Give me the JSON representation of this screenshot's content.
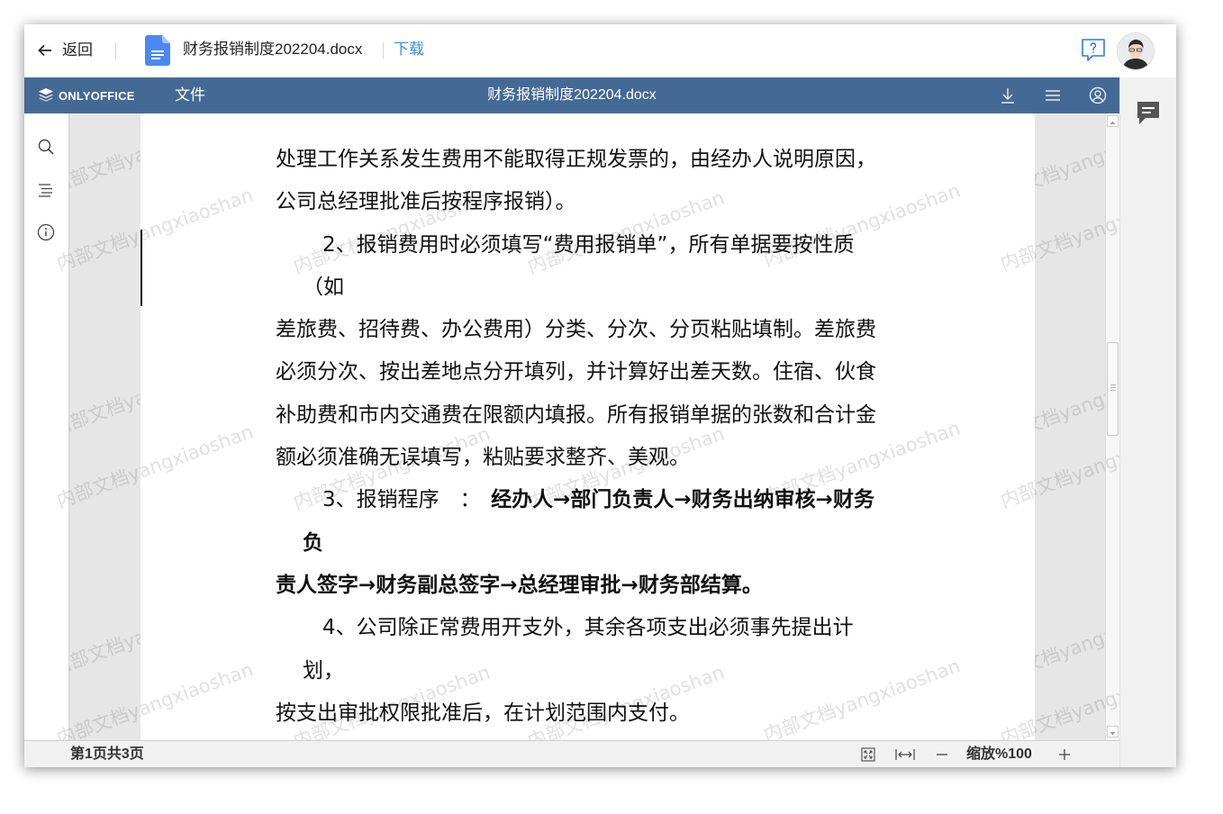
{
  "topbar": {
    "back_label": "返回",
    "filename": "财务报销制度202204.docx",
    "download_label": "下载",
    "icons": {
      "back": "arrow-left-icon",
      "file": "docx-file-icon",
      "help": "help-chat-icon",
      "avatar": "user-avatar"
    }
  },
  "editor_header": {
    "logo_text": "ONLYOFFICE",
    "file_menu_label": "文件",
    "title": "财务报销制度202204.docx",
    "icons": [
      "download-icon",
      "menu-icon",
      "account-icon"
    ]
  },
  "left_sidebar": {
    "icons": [
      "search-icon",
      "navigation-icon",
      "info-icon"
    ]
  },
  "right_sidebar": {
    "icons": [
      "comments-icon"
    ]
  },
  "document": {
    "lines": [
      "处理工作关系发生费用不能取得正规发票的，由经办人说明原因，",
      "公司总经理批准后按程序报销）。",
      "2、报销费用时必须填写“费用报销单”，所有单据要按性质",
      "（如",
      "差旅费、招待费、办公费用）分类、分次、分页粘贴填制。差旅费",
      "必须分次、按出差地点分开填列，并计算好出差天数。住宿、伙食",
      "补助费和市内交通费在限额内填报。所有报销单据的张数和合计金",
      "额必须准确无误填写，粘贴要求整齐、美观。",
      {
        "normal": "3、报销程序　：　",
        "bold": "经办人→部门负责人→财务出纳审核→财务"
      },
      "负",
      "责人签字→财务副总签字→总经理审批→财务部结算。",
      "4、公司除正常费用开支外，其余各项支出必须事先提出计",
      "划，",
      "按支出审批权限批准后，在计划范围内支付。"
    ]
  },
  "watermark": {
    "text": "内部文档yangxiaoshan"
  },
  "status_bar": {
    "page_info": "第1页共3页",
    "zoom_label": "缩放%100",
    "icons": [
      "fit-page-icon",
      "fit-width-icon",
      "zoom-out-icon",
      "zoom-in-icon"
    ]
  },
  "colors": {
    "header": "#446995",
    "link": "#3f8ef0",
    "file_icon": "#4a89f3",
    "help_icon": "#2f7ae5"
  }
}
